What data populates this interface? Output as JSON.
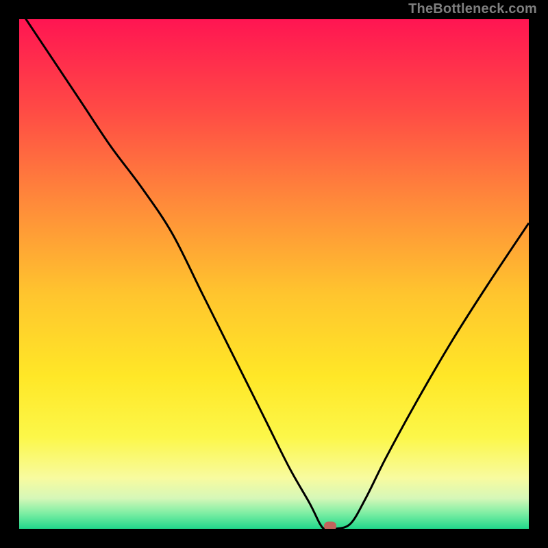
{
  "attribution": "TheBottleneck.com",
  "colors": {
    "background": "#000000",
    "curve": "#000000",
    "marker": "#c1645c",
    "attribution_text": "#7e7e7e",
    "gradient_stops": [
      {
        "pct": 0,
        "color": "#ff1552"
      },
      {
        "pct": 18,
        "color": "#ff4b45"
      },
      {
        "pct": 36,
        "color": "#ff8a3a"
      },
      {
        "pct": 54,
        "color": "#ffc52e"
      },
      {
        "pct": 70,
        "color": "#ffe727"
      },
      {
        "pct": 82,
        "color": "#fcf749"
      },
      {
        "pct": 90,
        "color": "#f8fb9f"
      },
      {
        "pct": 94,
        "color": "#d6f7b8"
      },
      {
        "pct": 97,
        "color": "#7ceea3"
      },
      {
        "pct": 100,
        "color": "#21d88b"
      }
    ]
  },
  "chart_data": {
    "type": "line",
    "title": "",
    "xlabel": "",
    "ylabel": "",
    "xlim": [
      0,
      100
    ],
    "ylim": [
      0,
      100
    ],
    "grid": false,
    "legend": false,
    "series": [
      {
        "name": "bottleneck-curve",
        "x": [
          0,
          6,
          12,
          18,
          24,
          30,
          36,
          42,
          48,
          53,
          57,
          59,
          60,
          62,
          65,
          68,
          72,
          78,
          85,
          92,
          100
        ],
        "y": [
          102,
          93,
          84,
          75,
          67,
          58,
          46,
          34,
          22,
          12,
          5,
          1,
          0,
          0,
          1,
          6,
          14,
          25,
          37,
          48,
          60
        ]
      }
    ],
    "markers": [
      {
        "name": "min-point",
        "x": 61,
        "y": 0.5
      }
    ]
  }
}
